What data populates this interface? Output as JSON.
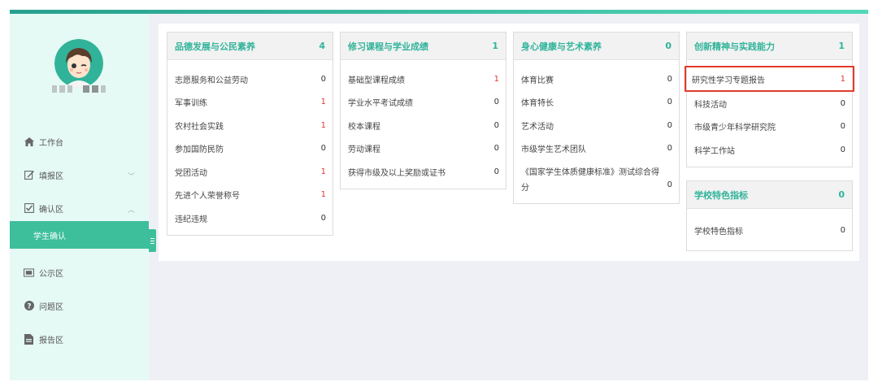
{
  "sidebar": {
    "avatar_icon": "cartoon-avatar",
    "nav": [
      {
        "label": "工作台",
        "icon": "home-icon"
      },
      {
        "label": "填报区",
        "icon": "edit-icon",
        "chevron": "﹀"
      },
      {
        "label": "确认区",
        "icon": "check-square-icon",
        "chevron": "︿"
      },
      {
        "label": "公示区",
        "icon": "display-icon"
      },
      {
        "label": "问题区",
        "icon": "question-icon"
      },
      {
        "label": "报告区",
        "icon": "report-icon"
      }
    ],
    "active_sub": {
      "label": "学生确认"
    }
  },
  "colors": {
    "accent": "#3dbf9c",
    "title": "#31b39a",
    "highlight_border": "#e23b2a",
    "red_value": "#e03535"
  },
  "cards": [
    {
      "title": "品德发展与公民素养",
      "count": "4",
      "items": [
        {
          "label": "志愿服务和公益劳动",
          "value": "0"
        },
        {
          "label": "军事训练",
          "value": "1"
        },
        {
          "label": "农村社会实践",
          "value": "1"
        },
        {
          "label": "参加国防民防",
          "value": "0"
        },
        {
          "label": "党团活动",
          "value": "1"
        },
        {
          "label": "先进个人荣誉称号",
          "value": "1"
        },
        {
          "label": "违纪违规",
          "value": "0"
        }
      ]
    },
    {
      "title": "修习课程与学业成绩",
      "count": "1",
      "items": [
        {
          "label": "基础型课程成绩",
          "value": "1"
        },
        {
          "label": "学业水平考试成绩",
          "value": "0"
        },
        {
          "label": "校本课程",
          "value": "0"
        },
        {
          "label": "劳动课程",
          "value": "0"
        },
        {
          "label": "获得市级及以上奖励或证书",
          "value": "0"
        }
      ]
    },
    {
      "title": "身心健康与艺术素养",
      "count": "0",
      "items": [
        {
          "label": "体育比赛",
          "value": "0"
        },
        {
          "label": "体育特长",
          "value": "0"
        },
        {
          "label": "艺术活动",
          "value": "0"
        },
        {
          "label": "市级学生艺术团队",
          "value": "0"
        },
        {
          "label": "《国家学生体质健康标准》测试综合得分",
          "value": "0"
        }
      ]
    },
    {
      "title": "创新精神与实践能力",
      "count": "1",
      "items": [
        {
          "label": "研究性学习专题报告",
          "value": "1"
        },
        {
          "label": "科技活动",
          "value": "0"
        },
        {
          "label": "市级青少年科学研究院",
          "value": "0"
        },
        {
          "label": "科学工作站",
          "value": "0"
        }
      ]
    },
    {
      "title": "学校特色指标",
      "count": "0",
      "items": [
        {
          "label": "学校特色指标",
          "value": "0"
        }
      ]
    }
  ]
}
